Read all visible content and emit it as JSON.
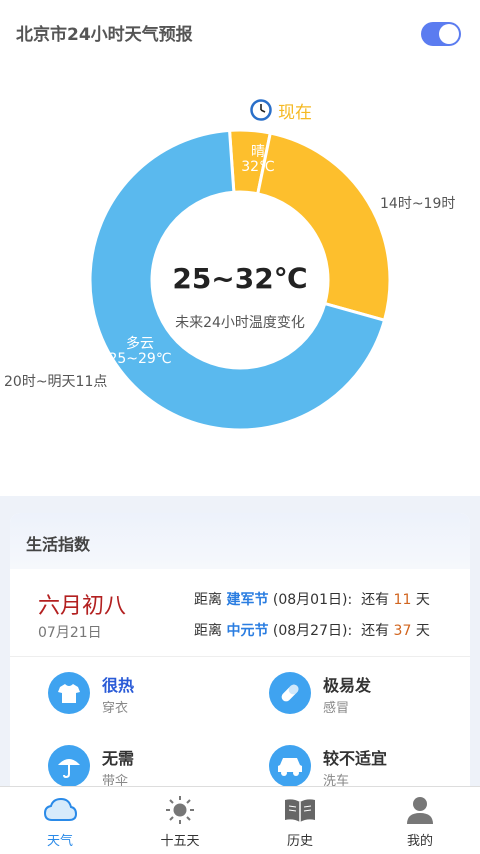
{
  "header": {
    "title": "北京市24小时天气预报"
  },
  "now": {
    "label": "现在"
  },
  "chart_data": {
    "type": "pie",
    "center_value": "25~32℃",
    "center_caption": "未来24小时温度变化",
    "segments": [
      {
        "weather": "晴",
        "temp": "32℃",
        "time": "",
        "value": 1,
        "color": "#fdbf2d"
      },
      {
        "weather": "",
        "temp": "",
        "time": "14时~19时",
        "value": 6,
        "color": "#fdbf2d"
      },
      {
        "weather": "多云",
        "temp": "25~29℃",
        "time": "20时~明天11点",
        "value": 16,
        "color": "#5ab9ee"
      }
    ]
  },
  "life": {
    "title": "生活指数",
    "lunar": "六月初八",
    "date": "07月21日",
    "festivals": [
      {
        "prefix": "距离",
        "name": "建军节",
        "date": "(08月01日):",
        "remain": "还有",
        "days": "11",
        "unit": "天"
      },
      {
        "prefix": "距离",
        "name": "中元节",
        "date": "(08月27日):",
        "remain": "还有",
        "days": "37",
        "unit": "天"
      }
    ],
    "indices": [
      {
        "value": "很热",
        "label": "穿衣",
        "icon": "shirt-icon"
      },
      {
        "value": "极易发",
        "label": "感冒",
        "icon": "pill-icon"
      },
      {
        "value": "无需",
        "label": "带伞",
        "icon": "umbrella-icon"
      },
      {
        "value": "较不适宜",
        "label": "洗车",
        "icon": "car-icon"
      }
    ]
  },
  "tabs": [
    {
      "label": "天气",
      "icon": "cloud-icon",
      "active": true
    },
    {
      "label": "十五天",
      "icon": "sun-icon"
    },
    {
      "label": "历史",
      "icon": "book-icon"
    },
    {
      "label": "我的",
      "icon": "user-icon"
    }
  ]
}
